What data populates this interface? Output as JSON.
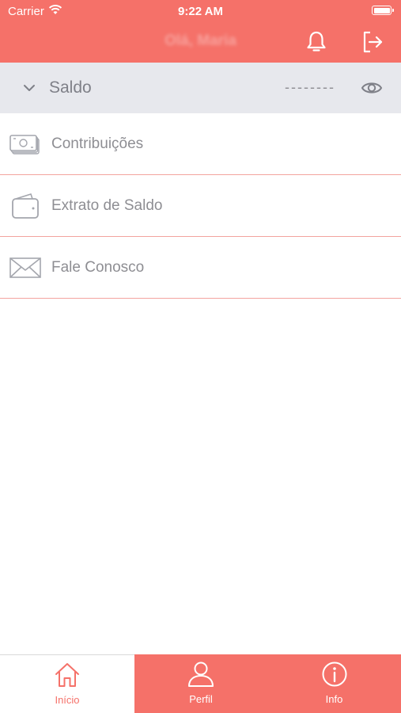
{
  "status_bar": {
    "carrier": "Carrier",
    "time": "9:22 AM"
  },
  "header": {
    "title": "Olá, Maria",
    "icons": [
      "bell-icon",
      "logout-icon"
    ]
  },
  "saldo": {
    "label": "Saldo",
    "value": "--------"
  },
  "menu": [
    {
      "label": "Contribuições",
      "icon": "money-icon"
    },
    {
      "label": "Extrato de Saldo",
      "icon": "wallet-icon"
    },
    {
      "label": "Fale Conosco",
      "icon": "mail-icon"
    }
  ],
  "tabs": [
    {
      "label": "Início",
      "icon": "home-icon"
    },
    {
      "label": "Perfil",
      "icon": "user-icon"
    },
    {
      "label": "Info",
      "icon": "info-icon"
    }
  ],
  "colors": {
    "accent": "#f57169",
    "divider": "#f3a49f",
    "saldo_bg": "#e7e8ed",
    "text_gray": "#8e8e93"
  }
}
